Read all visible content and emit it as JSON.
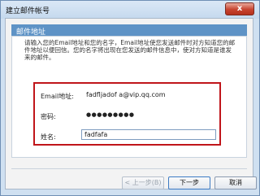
{
  "window": {
    "title": "建立邮件帐号",
    "close_symbol": "x"
  },
  "section": {
    "title": "邮件地址"
  },
  "instructions": "请输入您的Email地址和您的名字，Email地址使您发送邮件时对方知道您的邮件地址以便回信。您的名字将出现在您发送的邮件信息中，使对方知道是谁发来的邮件。",
  "fields": {
    "email": {
      "label": "Email地址:",
      "value": "fadfljadof a@vip.qq.com"
    },
    "password": {
      "label": "密码:",
      "value": "●●●●●●●●●"
    },
    "name": {
      "label": "姓名:",
      "value": "fadfafa"
    }
  },
  "buttons": {
    "back": "< 上一步(B)",
    "next": "下一步",
    "cancel": "取消"
  },
  "colors": {
    "highlight": "#c0151a",
    "section_header": "#5e93c6",
    "close_button": "#c7432f"
  }
}
